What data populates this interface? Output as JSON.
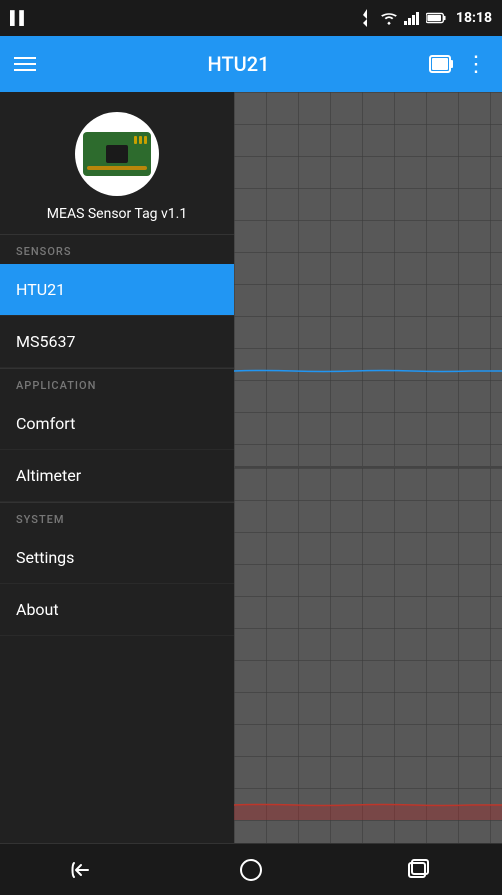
{
  "statusBar": {
    "time": "18:18",
    "battery_icon": "🔋",
    "bluetooth_symbol": "bluetooth",
    "wifi_symbol": "wifi",
    "signal_symbol": "signal"
  },
  "appBar": {
    "title": "HTU21",
    "menu_label": "Menu",
    "battery_label": "Battery",
    "more_label": "More options"
  },
  "sidebar": {
    "device": {
      "name": "MEAS Sensor Tag v1.1"
    },
    "sections": [
      {
        "id": "sensors",
        "label": "SENSORS",
        "items": [
          {
            "id": "htu21",
            "label": "HTU21",
            "active": true
          },
          {
            "id": "ms5637",
            "label": "MS5637",
            "active": false
          }
        ]
      },
      {
        "id": "application",
        "label": "APPLICATION",
        "items": [
          {
            "id": "comfort",
            "label": "Comfort",
            "active": false
          },
          {
            "id": "altimeter",
            "label": "Altimeter",
            "active": false
          }
        ]
      },
      {
        "id": "system",
        "label": "SYSTEM",
        "items": [
          {
            "id": "settings",
            "label": "Settings",
            "active": false
          },
          {
            "id": "about",
            "label": "About",
            "active": false
          }
        ]
      }
    ]
  },
  "bottomNav": {
    "back_label": "Back",
    "home_label": "Home",
    "recents_label": "Recents"
  }
}
